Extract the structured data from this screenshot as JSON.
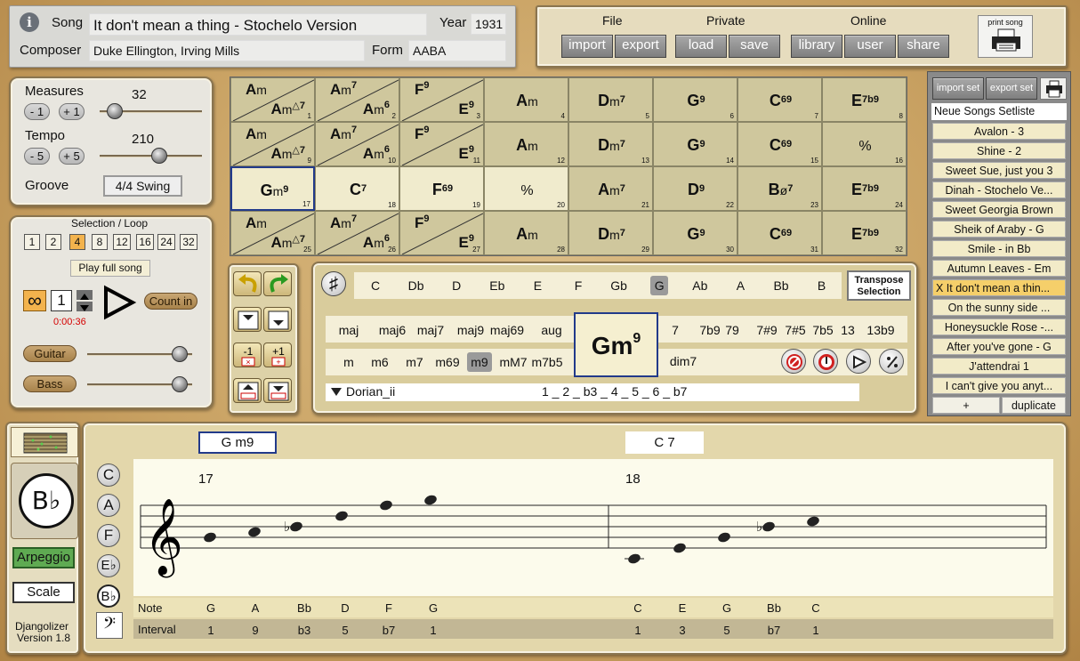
{
  "song": {
    "song_label": "Song",
    "title": "It don't mean a thing - Stochelo Version",
    "year_label": "Year",
    "year": "1931",
    "composer_label": "Composer",
    "composer": "Duke Ellington, Irving Mills",
    "form_label": "Form",
    "form": "AABA",
    "info_icon": "i"
  },
  "menu": {
    "file_label": "File",
    "import": "import",
    "export": "export",
    "private_label": "Private",
    "load": "load",
    "save": "save",
    "online_label": "Online",
    "library": "library",
    "user": "user",
    "share": "share",
    "print_label": "print song"
  },
  "measures": {
    "label": "Measures",
    "value": "32",
    "minus": "- 1",
    "plus": "+ 1",
    "fraction": 0.08
  },
  "tempo": {
    "label": "Tempo",
    "value": "210",
    "minus": "- 5",
    "plus": "+ 5",
    "fraction": 0.6
  },
  "groove": {
    "label": "Groove",
    "value": "4/4 Swing"
  },
  "selection": {
    "title": "Selection / Loop",
    "lengths": [
      "1",
      "2",
      "4",
      "8",
      "12",
      "16",
      "24",
      "32"
    ],
    "active": "4",
    "play_full": "Play full song",
    "loop_count": "1",
    "time": "0:00:36",
    "count_in": "Count in",
    "guitar": "Guitar",
    "bass": "Bass",
    "guitar_level": 0.95,
    "bass_level": 0.95
  },
  "grid": [
    [
      {
        "t": "Am",
        "b": "Am△7",
        "n": "1"
      },
      {
        "t": "Am7",
        "b": "Am6",
        "n": "2"
      },
      {
        "t": "F9",
        "b": "E9",
        "n": "3"
      },
      {
        "m": "Am",
        "n": "4"
      },
      {
        "m": "Dm7",
        "n": "5"
      },
      {
        "m": "G9",
        "n": "6"
      },
      {
        "m": "C69",
        "n": "7"
      },
      {
        "m": "E7b9",
        "n": "8"
      }
    ],
    [
      {
        "t": "Am",
        "b": "Am△7",
        "n": "9"
      },
      {
        "t": "Am7",
        "b": "Am6",
        "n": "10"
      },
      {
        "t": "F9",
        "b": "E9",
        "n": "11"
      },
      {
        "m": "Am",
        "n": "12"
      },
      {
        "m": "Dm7",
        "n": "13"
      },
      {
        "m": "G9",
        "n": "14"
      },
      {
        "m": "C69",
        "n": "15"
      },
      {
        "m": "⁒",
        "n": "16"
      }
    ],
    [
      {
        "m": "Gm9",
        "n": "17",
        "sel": true,
        "cur": true
      },
      {
        "m": "C7",
        "n": "18",
        "sel": true
      },
      {
        "m": "F69",
        "n": "19",
        "sel": true
      },
      {
        "m": "⁒",
        "n": "20",
        "sel": true
      },
      {
        "m": "Am7",
        "n": "21"
      },
      {
        "m": "D9",
        "n": "22"
      },
      {
        "m": "Bø7",
        "n": "23"
      },
      {
        "m": "E7b9",
        "n": "24"
      }
    ],
    [
      {
        "t": "Am",
        "b": "Am△7",
        "n": "25"
      },
      {
        "t": "Am7",
        "b": "Am6",
        "n": "26"
      },
      {
        "t": "F9",
        "b": "E9",
        "n": "27"
      },
      {
        "m": "Am",
        "n": "28"
      },
      {
        "m": "Dm7",
        "n": "29"
      },
      {
        "m": "G9",
        "n": "30"
      },
      {
        "m": "C69",
        "n": "31"
      },
      {
        "m": "E7b9",
        "n": "32"
      }
    ]
  ],
  "setlist": {
    "import": "import set",
    "export": "export set",
    "name": "Neue Songs Setliste",
    "items": [
      "Avalon - 3",
      "Shine - 2",
      "Sweet Sue, just you 3",
      "Dinah - Stochelo Ve...",
      "Sweet Georgia Brown",
      "Sheik of Araby - G",
      "Smile - in Bb",
      "Autumn Leaves - Em",
      "X It don't mean a thin...",
      "On the sunny side ...",
      "Honeysuckle Rose -...",
      "After you've gone - G",
      "J'attendrai 1",
      "I can't give you anyt..."
    ],
    "current_index": 8,
    "add": "+",
    "duplicate": "duplicate"
  },
  "chord_editor": {
    "sharp": "♯",
    "roots": [
      "C",
      "Db",
      "D",
      "Eb",
      "E",
      "F",
      "Gb",
      "G",
      "Ab",
      "A",
      "Bb",
      "B"
    ],
    "active_root": "G",
    "transpose": "Transpose Selection",
    "qualities_row1": [
      "maj",
      "maj6",
      "maj7",
      "maj9",
      "maj69",
      "aug"
    ],
    "qualities_row2": [
      "m",
      "m6",
      "m7",
      "m69",
      "m9",
      "mM7",
      "m7b5"
    ],
    "active_quality": "m9",
    "extensions_row1": [
      "7",
      "7b9",
      "79",
      "7#9",
      "7#5",
      "7b5",
      "13",
      "13b9"
    ],
    "extensions_row2": [
      "dim7"
    ],
    "current_chord": "Gm",
    "current_sup": "9",
    "scale_name": "Dorian_ii",
    "scale_degrees": "1 _ 2 _ b3 _ 4 _ 5 _ 6 _ b7"
  },
  "notation": {
    "chord1": "G m9",
    "chord2": "C 7",
    "measure1": "17",
    "measure2": "18",
    "key": "B♭",
    "arpeggio": "Arpeggio",
    "scale": "Scale",
    "transpose_keys": [
      "C",
      "A",
      "F",
      "E♭",
      "B♭"
    ],
    "note_label": "Note",
    "interval_label": "Interval",
    "notes1": [
      "G",
      "A",
      "Bb",
      "D",
      "F",
      "G"
    ],
    "intervals1": [
      "1",
      "9",
      "b3",
      "5",
      "b7",
      "1"
    ],
    "notes2": [
      "C",
      "E",
      "G",
      "Bb",
      "C"
    ],
    "intervals2": [
      "1",
      "3",
      "5",
      "b7",
      "1"
    ],
    "app": "Djangolizer",
    "version": "Version 1.8"
  }
}
